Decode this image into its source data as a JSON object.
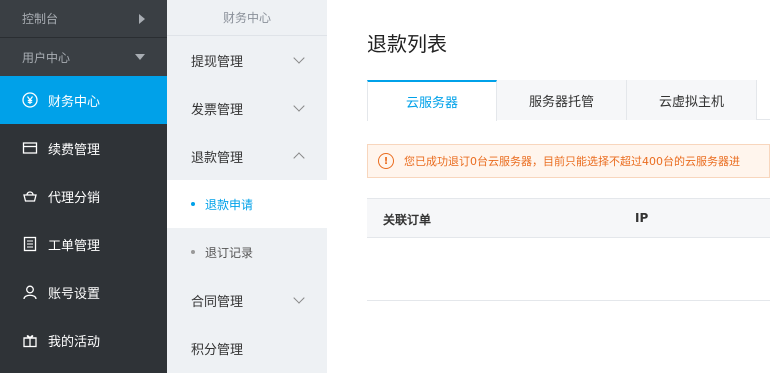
{
  "nav": {
    "console": "控制台",
    "user_center": "用户中心",
    "items": [
      {
        "label": "财务中心",
        "icon": "yen-circle-icon"
      },
      {
        "label": "续费管理",
        "icon": "card-icon"
      },
      {
        "label": "代理分销",
        "icon": "basket-icon"
      },
      {
        "label": "工单管理",
        "icon": "document-icon"
      },
      {
        "label": "账号设置",
        "icon": "user-icon"
      },
      {
        "label": "我的活动",
        "icon": "gift-icon"
      }
    ]
  },
  "subnav": {
    "header": "财务中心",
    "withdraw": "提现管理",
    "invoice": "发票管理",
    "refund": "退款管理",
    "refund_apply": "退款申请",
    "unsubscribe_records": "退订记录",
    "contract": "合同管理",
    "points": "积分管理"
  },
  "main": {
    "title": "退款列表",
    "tabs": [
      "云服务器",
      "服务器托管",
      "云虚拟主机"
    ],
    "notice": "您已成功退订0台云服务器，目前只能选择不超过400台的云服务器进",
    "columns": [
      "关联订单",
      "IP"
    ]
  },
  "colors": {
    "accent": "#00a1e9",
    "warning": "#ea6d20"
  }
}
